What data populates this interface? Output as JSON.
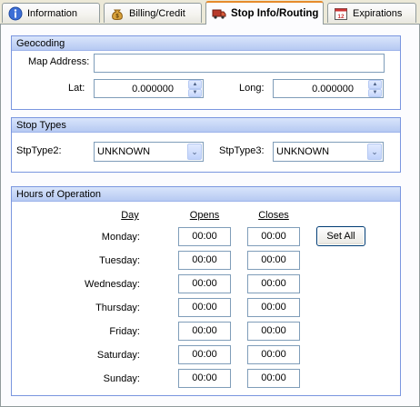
{
  "tabs": [
    {
      "label": "Information",
      "icon": "info-icon"
    },
    {
      "label": "Billing/Credit",
      "icon": "money-bag-icon"
    },
    {
      "label": "Stop Info/Routing",
      "icon": "truck-icon",
      "active": true
    },
    {
      "label": "Expirations",
      "icon": "calendar-icon"
    }
  ],
  "geocoding": {
    "title": "Geocoding",
    "map_address_label": "Map Address:",
    "map_address_value": "",
    "lat_label": "Lat:",
    "lat_value": "0.000000",
    "long_label": "Long:",
    "long_value": "0.000000"
  },
  "stop_types": {
    "title": "Stop Types",
    "type2_label": "StpType2:",
    "type2_value": "UNKNOWN",
    "type3_label": "StpType3:",
    "type3_value": "UNKNOWN"
  },
  "hours": {
    "title": "Hours of Operation",
    "col_day": "Day",
    "col_opens": "Opens",
    "col_closes": "Closes",
    "set_all_label": "Set All",
    "rows": [
      {
        "day": "Monday:",
        "opens": "00:00",
        "closes": "00:00"
      },
      {
        "day": "Tuesday:",
        "opens": "00:00",
        "closes": "00:00"
      },
      {
        "day": "Wednesday:",
        "opens": "00:00",
        "closes": "00:00"
      },
      {
        "day": "Thursday:",
        "opens": "00:00",
        "closes": "00:00"
      },
      {
        "day": "Friday:",
        "opens": "00:00",
        "closes": "00:00"
      },
      {
        "day": "Saturday:",
        "opens": "00:00",
        "closes": "00:00"
      },
      {
        "day": "Sunday:",
        "opens": "00:00",
        "closes": "00:00"
      }
    ]
  },
  "colors": {
    "active_tab_accent": "#e68b2c",
    "group_header": "#c3d3f7",
    "input_border": "#7f9db9"
  }
}
